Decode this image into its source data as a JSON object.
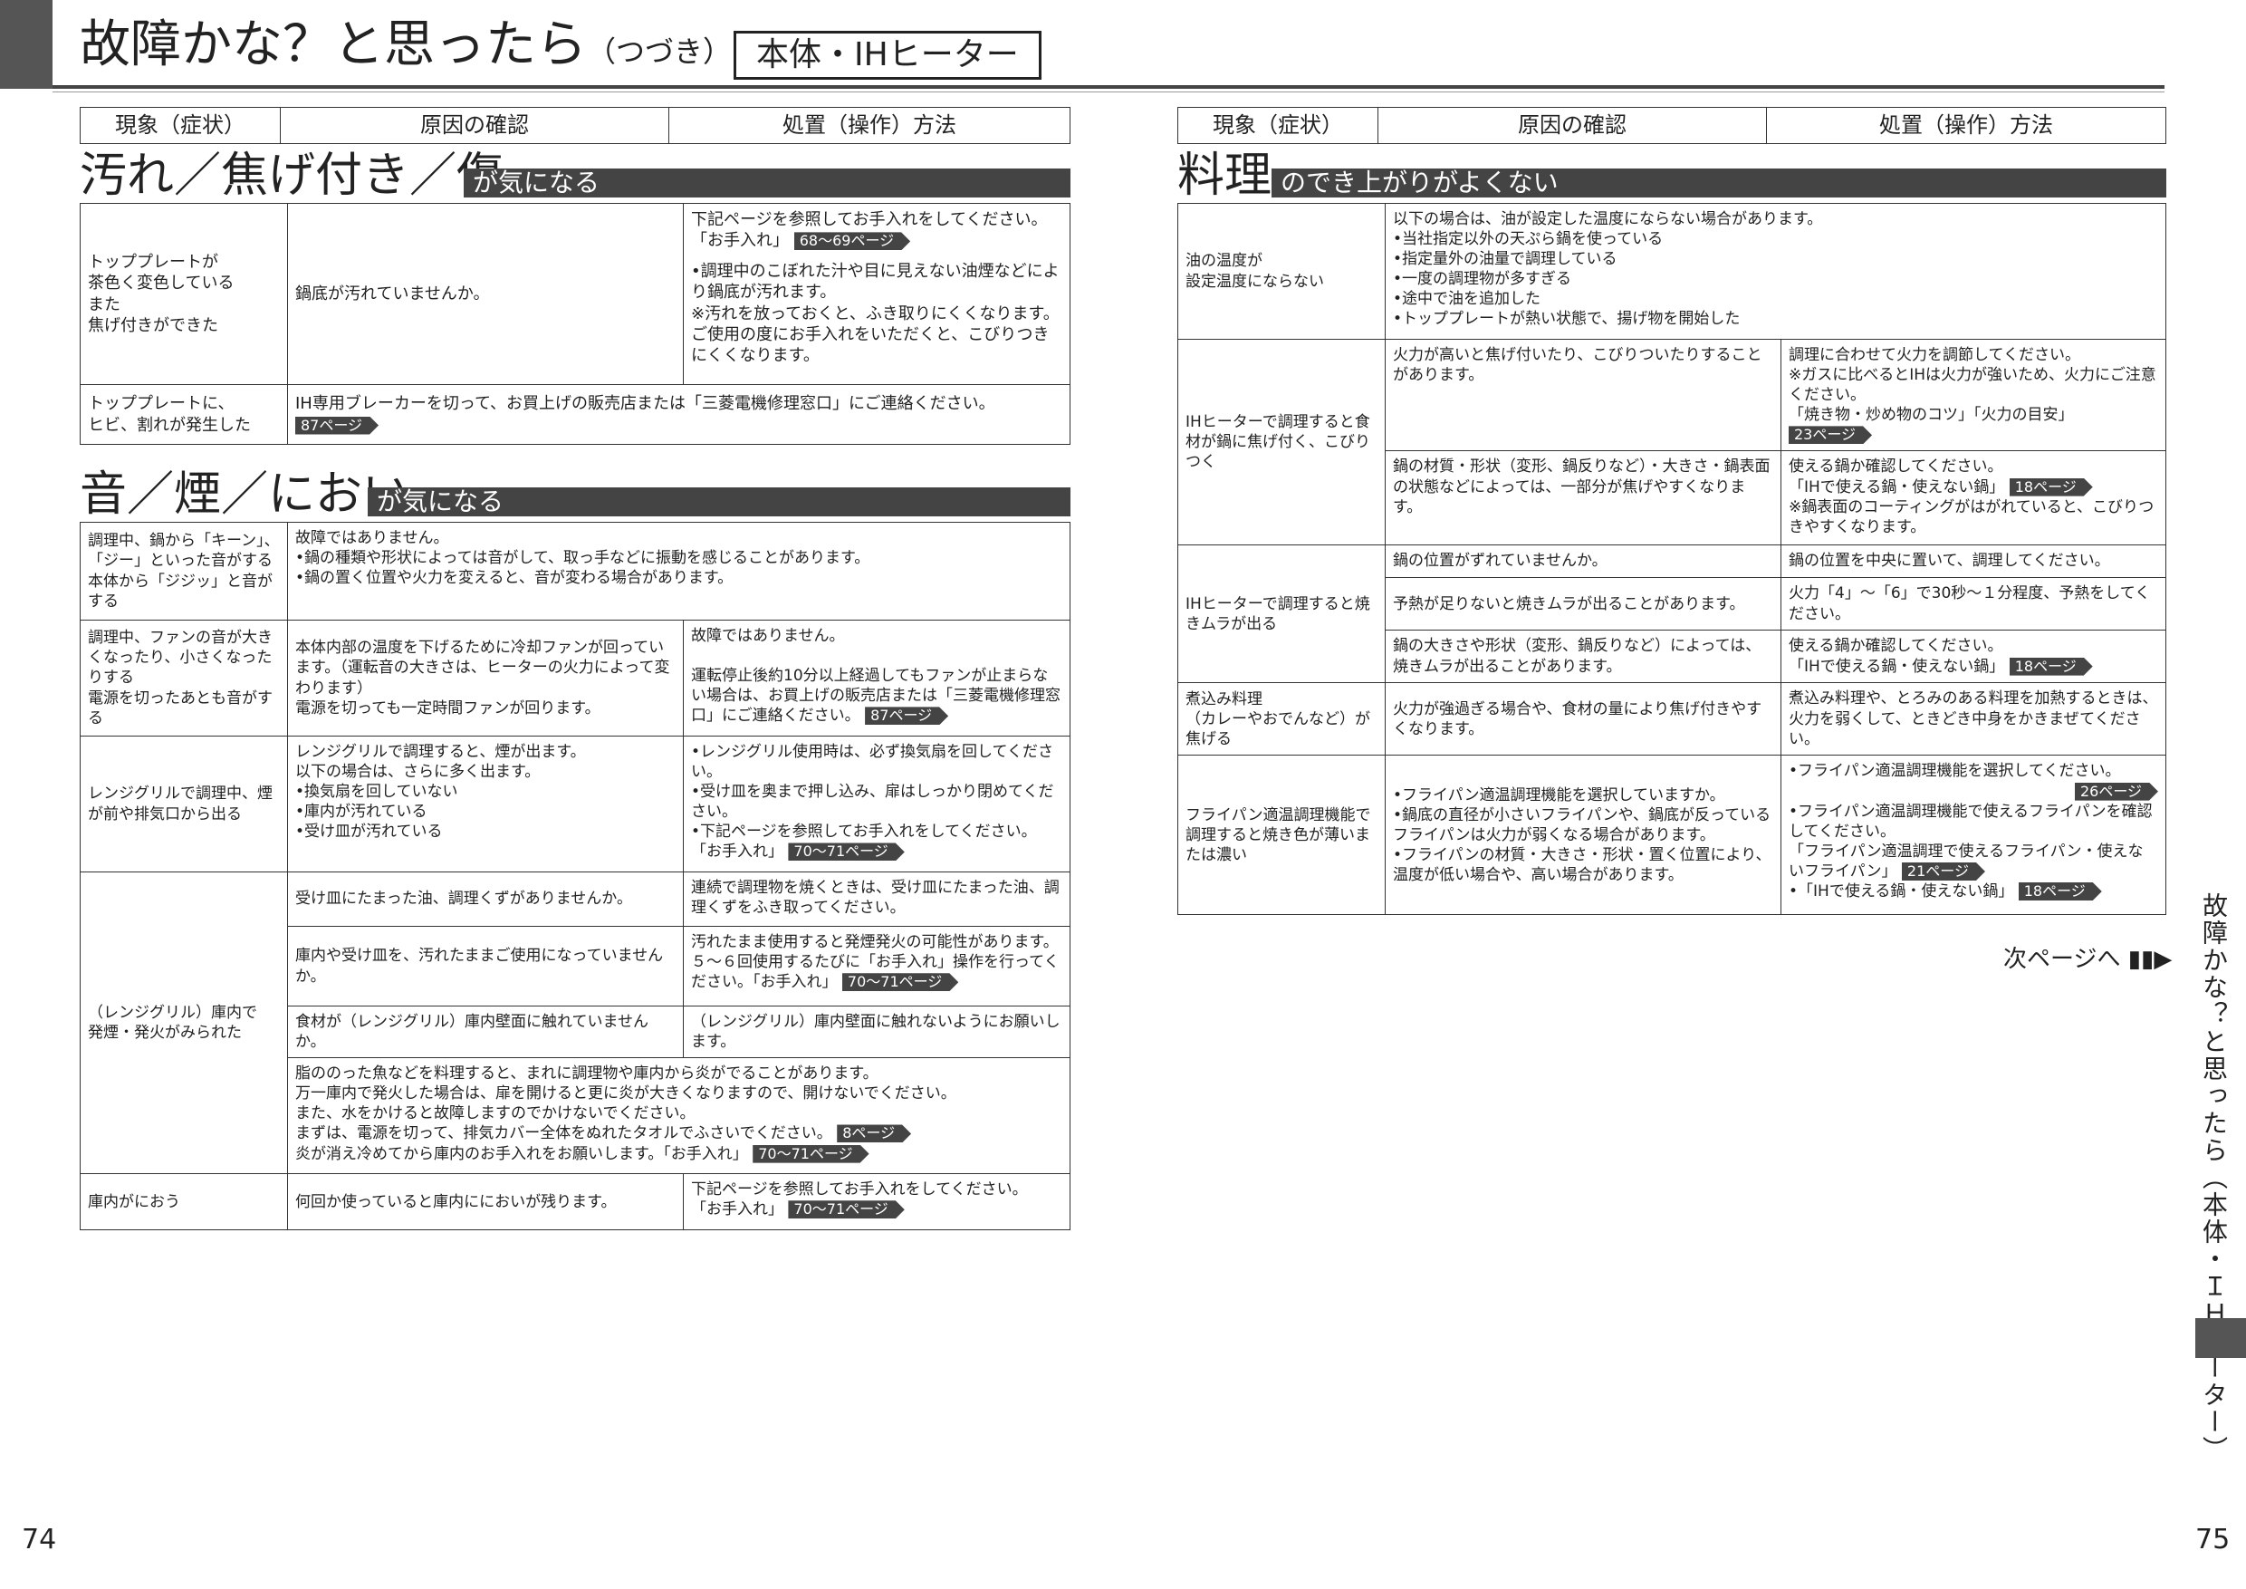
{
  "title": {
    "main": "故障かな？と思ったら",
    "sub": "（つづき）",
    "box": "本体・IHヒーター"
  },
  "headers": {
    "symptom": "現象（症状）",
    "cause": "原因の確認",
    "remedy": "処置（操作）方法"
  },
  "sections": {
    "dirt": {
      "big": "汚れ／焦げ付き／傷",
      "bar": "が気になる"
    },
    "sound": {
      "big": "音／煙／におい",
      "bar": "が気になる"
    },
    "cook": {
      "big": "料理",
      "bar": "のでき上がりがよくない"
    }
  },
  "left": {
    "r1": {
      "sym": "トッププレートが\n茶色く変色している\nまた\n焦げ付きができた",
      "cause": "鍋底が汚れていませんか。",
      "remedy_a": "下記ページを参照してお手入れをしてください。",
      "remedy_b": "「お手入れ」",
      "ref": "68～69ページ",
      "remedy_c": "•調理中のこぼれた汁や目に見えない油煙などにより鍋底が汚れます。\n※汚れを放っておくと、ふき取りにくくなります。ご使用の度にお手入れをいただくと、こびりつきにくくなります。"
    },
    "r2": {
      "sym": "トッププレートに、\nヒビ、割れが発生した",
      "text": "IH専用ブレーカーを切って、お買上げの販売店または「三菱電機修理窓口」にご連絡ください。",
      "ref": "87ページ"
    },
    "s1": {
      "sym": "調理中、鍋から「キーン」、「ジー」といった音がする\n本体から「ジジッ」と音がする",
      "text": "故障ではありません。\n•鍋の種類や形状によっては音がして、取っ手などに振動を感じることがあります。\n•鍋の置く位置や火力を変えると、音が変わる場合があります。"
    },
    "s2": {
      "sym": "調理中、ファンの音が大きくなったり、小さくなったりする\n電源を切ったあとも音がする",
      "cause": "本体内部の温度を下げるために冷却ファンが回っています。（運転音の大きさは、ヒーターの火力によって変わります）\n電源を切っても一定時間ファンが回ります。",
      "remedy": "故障ではありません。\n\n運転停止後約10分以上経過してもファンが止まらない場合は、お買上げの販売店または「三菱電機修理窓口」にご連絡ください。",
      "ref": "87ページ"
    },
    "s3": {
      "sym": "レンジグリルで調理中、煙が前や排気口から出る",
      "cause": "レンジグリルで調理すると、煙が出ます。\n以下の場合は、さらに多く出ます。\n•換気扇を回していない\n•庫内が汚れている\n•受け皿が汚れている",
      "remedy": "•レンジグリル使用時は、必ず換気扇を回してください。\n•受け皿を奥まで押し込み、扉はしっかり閉めてください。\n•下記ページを参照してお手入れをしてください。",
      "remedy_b": "「お手入れ」",
      "ref": "70～71ページ"
    },
    "s4": {
      "sym": "（レンジグリル）庫内で\n発煙・発火がみられた",
      "c1": "受け皿にたまった油、調理くずがありませんか。",
      "r1": "連続で調理物を焼くときは、受け皿にたまった油、調理くずをふき取ってください。",
      "c2": "庫内や受け皿を、汚れたままご使用になっていませんか。",
      "r2": "汚れたまま使用すると発煙発火の可能性があります。５～６回使用するたびに「お手入れ」操作を行ってください。「お手入れ」",
      "ref2": "70～71ページ",
      "c3": "食材が（レンジグリル）庫内壁面に触れていませんか。",
      "r3": "（レンジグリル）庫内壁面に触れないようにお願いします。",
      "c4": "脂ののった魚などを料理すると、まれに調理物や庫内から炎がでることがあります。\n万一庫内で発火した場合は、扉を開けると更に炎が大きくなりますので、開けないでください。\nまた、水をかけると故障しますのでかけないでください。\nまずは、電源を切って、排気カバー全体をぬれたタオルでふさいでください。",
      "ref4a": "8ページ",
      "c4b": "炎が消え冷めてから庫内のお手入れをお願いします。「お手入れ」",
      "ref4b": "70～71ページ"
    },
    "s5": {
      "sym": "庫内がにおう",
      "cause": "何回か使っていると庫内ににおいが残ります。",
      "remedy": "下記ページを参照してお手入れをしてください。",
      "remedy_b": "「お手入れ」",
      "ref": "70～71ページ"
    }
  },
  "right": {
    "c1": {
      "sym": "油の温度が\n設定温度にならない",
      "text": "以下の場合は、油が設定した温度にならない場合があります。\n•当社指定以外の天ぷら鍋を使っている\n•指定量外の油量で調理している\n•一度の調理物が多すぎる\n•途中で油を追加した\n•トッププレートが熱い状態で、揚げ物を開始した"
    },
    "c2": {
      "sym": "IHヒーターで調理すると食材が鍋に焦げ付く、こびりつく",
      "ca": "火力が高いと焦げ付いたり、こびりついたりすることがあります。",
      "ra": "調理に合わせて火力を調節してください。\n※ガスに比べるとIHは火力が強いため、火力にご注意ください。",
      "ra2": "「焼き物・炒め物のコツ」「火力の目安」",
      "refa": "23ページ",
      "cb": "鍋の材質・形状（変形、鍋反りなど）・大きさ・鍋表面の状態などによっては、一部分が焦げやすくなります。",
      "rb": "使える鍋か確認してください。",
      "rb2": "「IHで使える鍋・使えない鍋」",
      "refb": "18ページ",
      "rb3": "※鍋表面のコーティングがはがれていると、こびりつきやすくなります。"
    },
    "c3": {
      "sym": "IHヒーターで調理すると焼きムラが出る",
      "ca": "鍋の位置がずれていませんか。",
      "ra": "鍋の位置を中央に置いて、調理してください。",
      "cb": "予熱が足りないと焼きムラが出ることがあります。",
      "rb": "火力「4」～「6」で30秒～１分程度、予熱をしてください。",
      "cc": "鍋の大きさや形状（変形、鍋反りなど）によっては、焼きムラが出ることがあります。",
      "rc": "使える鍋か確認してください。",
      "rc2": "「IHで使える鍋・使えない鍋」",
      "refc": "18ページ"
    },
    "c4": {
      "sym": "煮込み料理\n（カレーやおでんなど）が焦げる",
      "cause": "火力が強過ぎる場合や、食材の量により焦げ付きやすくなります。",
      "remedy": "煮込み料理や、とろみのある料理を加熱するときは、火力を弱くして、ときどき中身をかきまぜてください。"
    },
    "c5": {
      "sym": "フライパン適温調理機能で調理すると焼き色が薄いまたは濃い",
      "cause": "•フライパン適温調理機能を選択していますか。\n•鍋底の直径が小さいフライパンや、鍋底が反っているフライパンは火力が弱くなる場合があります。\n•フライパンの材質・大きさ・形状・置く位置により、温度が低い場合や、高い場合があります。",
      "r1": "•フライパン適温調理機能を選択してください。",
      "ref1": "26ページ",
      "r2": "•フライパン適温調理機能で使えるフライパンを確認してください。",
      "r3": "「フライパン適温調理で使えるフライパン・使えないフライパン」",
      "ref3": "21ページ",
      "r4": "•「IHで使える鍋・使えない鍋」",
      "ref4": "18ページ"
    }
  },
  "next": "次ページへ ▮▮▶",
  "side": "故障かな？と思ったら（本体・ＩＨヒーター）",
  "pages": {
    "left": "74",
    "right": "75"
  }
}
